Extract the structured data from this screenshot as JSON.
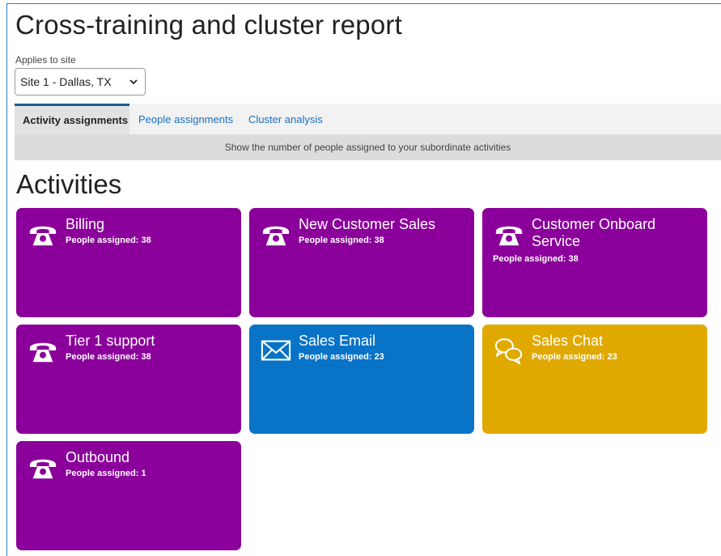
{
  "header": {
    "title": "Cross-training and cluster report",
    "site_label": "Applies to site",
    "site_value": "Site 1 - Dallas, TX"
  },
  "tabs": [
    {
      "label": "Activity assignments",
      "active": true
    },
    {
      "label": "People assignments",
      "active": false
    },
    {
      "label": "Cluster analysis",
      "active": false
    }
  ],
  "tab_description": "Show the number of people assigned to your subordinate activities",
  "section_title": "Activities",
  "colors": {
    "purple": "#8b009b",
    "blue": "#0873c7",
    "gold": "#e0a900",
    "active_tab_border": "#1a5f91",
    "link": "#1a6fbf"
  },
  "activities": [
    {
      "name": "Billing",
      "count": "People assigned: 38",
      "icon": "phone-icon"
    },
    {
      "name": "New Customer Sales",
      "count": "People assigned: 38",
      "icon": "phone-icon"
    },
    {
      "name": "Customer Onboard Service",
      "count": "People assigned: 38",
      "icon": "phone-icon"
    },
    {
      "name": "Tier 1 support",
      "count": "People assigned: 38",
      "icon": "phone-icon"
    },
    {
      "name": "Sales Email",
      "count": "People assigned: 23",
      "icon": "envelope-icon"
    },
    {
      "name": "Sales Chat",
      "count": "People assigned: 23",
      "icon": "chat-bubbles-icon"
    },
    {
      "name": "Outbound",
      "count": "People assigned: 1",
      "icon": "phone-icon"
    }
  ]
}
